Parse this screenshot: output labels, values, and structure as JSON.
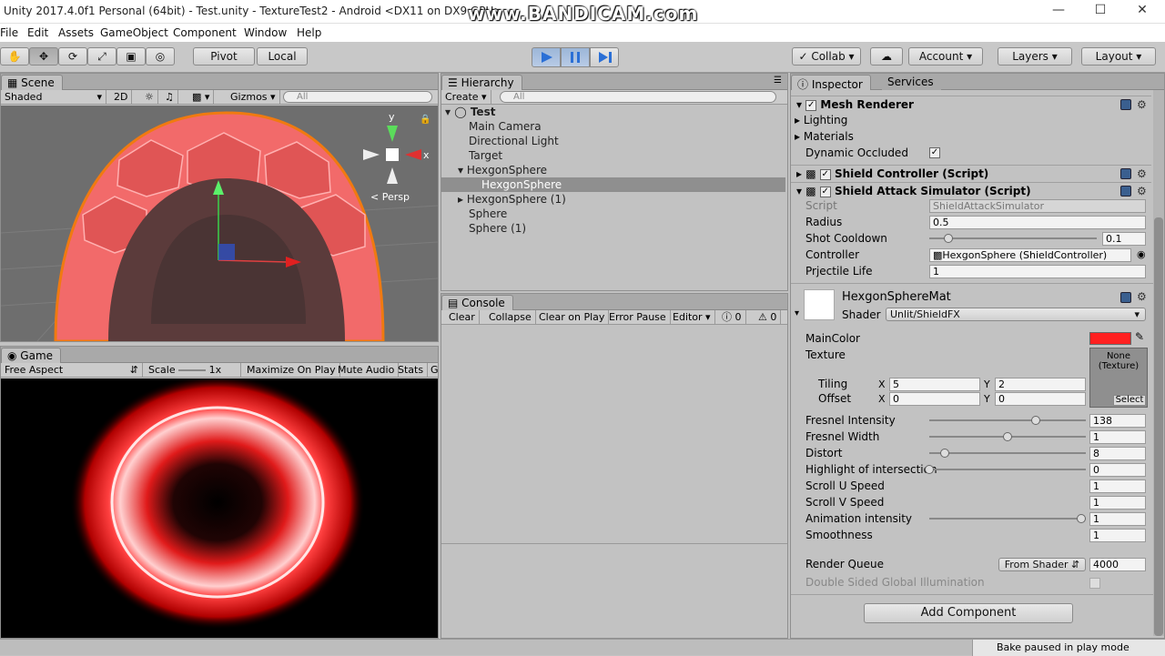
{
  "window": {
    "title": "Unity 2017.4.0f1 Personal (64bit) - Test.unity - TextureTest2 - Android <DX11 on DX9 GPU>",
    "watermark": "www.BANDICAM.com"
  },
  "menu": [
    "File",
    "Edit",
    "Assets",
    "GameObject",
    "Component",
    "Window",
    "Help"
  ],
  "toolbar": {
    "pivot": "Pivot",
    "local": "Local",
    "collab": "Collab",
    "account": "Account",
    "layers": "Layers",
    "layout": "Layout"
  },
  "scene": {
    "tab": "Scene",
    "shading": "Shaded",
    "mode2d": "2D",
    "gizmos": "Gizmos",
    "search_placeholder": "All",
    "persp": "Persp",
    "x_label": "x",
    "y_label": "y"
  },
  "game": {
    "tab": "Game",
    "aspect": "Free Aspect",
    "scale_label": "Scale",
    "scale_value": "1x",
    "maximize": "Maximize On Play",
    "mute": "Mute Audio",
    "stats": "Stats",
    "gizmos": "G"
  },
  "hierarchy": {
    "tab": "Hierarchy",
    "create": "Create",
    "search_placeholder": "All",
    "scene_name": "Test",
    "items": [
      {
        "label": "Main Camera"
      },
      {
        "label": "Directional Light"
      },
      {
        "label": "Target"
      },
      {
        "label": "HexgonSphere"
      },
      {
        "label": "HexgonSphere"
      },
      {
        "label": "HexgonSphere (1)"
      },
      {
        "label": "Sphere"
      },
      {
        "label": "Sphere (1)"
      }
    ]
  },
  "console": {
    "tab": "Console",
    "clear": "Clear",
    "collapse": "Collapse",
    "clear_on_play": "Clear on Play",
    "error_pause": "Error Pause",
    "editor": "Editor",
    "count1": "0",
    "count2": "0"
  },
  "inspector": {
    "tab": "Inspector",
    "tab2": "Services",
    "mesh_renderer": {
      "title": "Mesh Renderer",
      "lighting": "Lighting",
      "materials": "Materials",
      "dynamic_occluded": "Dynamic Occluded"
    },
    "shield_controller": {
      "title": "Shield Controller (Script)"
    },
    "shield_attack": {
      "title": "Shield Attack Simulator (Script)",
      "script_label": "Script",
      "script_value": "ShieldAttackSimulator",
      "radius_label": "Radius",
      "radius_value": "0.5",
      "cooldown_label": "Shot Cooldown",
      "cooldown_value": "0.1",
      "controller_label": "Controller",
      "controller_value": "HexgonSphere (ShieldController)",
      "life_label": "Prjectile Life",
      "life_value": "1"
    },
    "material": {
      "name": "HexgonSphereMat",
      "shader_label": "Shader",
      "shader_value": "Unlit/ShieldFX",
      "maincolor_label": "MainColor",
      "maincolor": "#ff2020",
      "texture_label": "Texture",
      "texture_none": "None",
      "texture_type": "(Texture)",
      "select": "Select",
      "tiling_label": "Tiling",
      "offset_label": "Offset",
      "x": "X",
      "y": "Y",
      "tiling_x": "5",
      "tiling_y": "2",
      "offset_x": "0",
      "offset_y": "0",
      "props": [
        {
          "label": "Fresnel Intensity",
          "value": "138",
          "slider": 0.68
        },
        {
          "label": "Fresnel Width",
          "value": "1",
          "slider": 0.5
        },
        {
          "label": "Distort",
          "value": "8",
          "slider": 0.1
        },
        {
          "label": "Highlight of intersection",
          "value": "0",
          "slider": 0.0
        },
        {
          "label": "Scroll U Speed",
          "value": "1"
        },
        {
          "label": "Scroll V Speed",
          "value": "1"
        },
        {
          "label": "Animation intensity",
          "value": "1",
          "slider": 0.97
        },
        {
          "label": "Smoothness",
          "value": "1"
        }
      ],
      "render_queue_label": "Render Queue",
      "render_queue_mode": "From Shader",
      "render_queue_value": "4000",
      "dsgi_label": "Double Sided Global Illumination"
    },
    "add_component": "Add Component"
  },
  "status": {
    "text": "Bake paused in play mode"
  }
}
